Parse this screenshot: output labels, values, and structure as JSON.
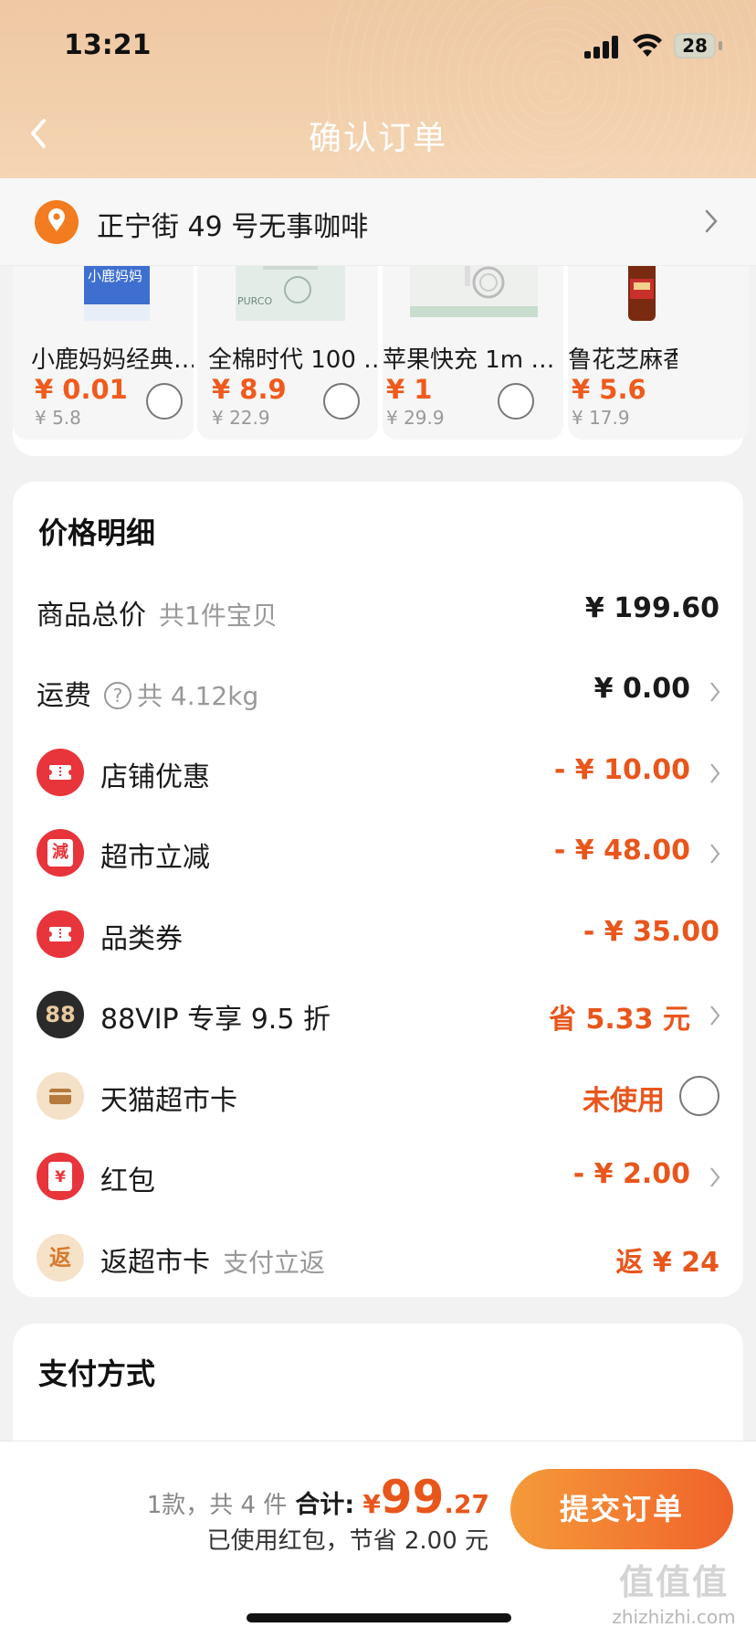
{
  "status_bar": {
    "time": "13:21",
    "battery": "28"
  },
  "header": {
    "title": "确认订单"
  },
  "address": {
    "text": "正宁街 49 号无事咖啡"
  },
  "products": [
    {
      "name": "小鹿妈妈经典…",
      "price": "¥ 0.01",
      "original": "¥ 5.8",
      "thumb_text": "小鹿妈妈"
    },
    {
      "name": "全棉时代 100 …",
      "price": "¥ 8.9",
      "original": "¥ 22.9",
      "thumb_text": "PURCO"
    },
    {
      "name": "苹果快充 1m …",
      "price": "¥ 1",
      "original": "¥ 29.9",
      "thumb_text": ""
    },
    {
      "name": "鲁花芝麻香",
      "price": "¥ 5.6",
      "original": "¥ 17.9",
      "thumb_text": ""
    }
  ],
  "price_detail": {
    "title": "价格明细",
    "rows": [
      {
        "label": "商品总价",
        "sub": "共1件宝贝",
        "value": "¥ 199.60"
      },
      {
        "label": "运费",
        "help": "?",
        "sub": "共 4.12kg",
        "value": "¥ 0.00"
      },
      {
        "label": "店铺优惠",
        "value": "- ¥ 10.00",
        "icon_text": ""
      },
      {
        "label": "超市立减",
        "value": "- ¥ 48.00",
        "icon_text": "減"
      },
      {
        "label": "品类券",
        "value": "- ¥ 35.00",
        "icon_text": ""
      },
      {
        "label": "88VIP 专享 9.5 折",
        "value": "省 5.33 元",
        "icon_text": "88"
      },
      {
        "label": "天猫超市卡",
        "value": "未使用",
        "icon_text": ""
      },
      {
        "label": "红包",
        "value": "- ¥ 2.00",
        "icon_text": "¥"
      },
      {
        "label": "返超市卡",
        "sub": "支付立返",
        "value": "返 ¥ 24",
        "icon_text": "返"
      }
    ]
  },
  "payment": {
    "title": "支付方式"
  },
  "bottom_bar": {
    "count": "1款，共 4 件",
    "total_label": "合计:",
    "yen": "¥",
    "total_int": "99",
    "total_dec": ".27",
    "saved": "已使用红包，节省 2.00 元",
    "submit": "提交订单"
  },
  "watermark": {
    "logo": "值值值",
    "url": "zhizhizhi.com"
  },
  "colors": {
    "accent": "#e8561c",
    "header": "#f2cfab",
    "red_icon": "#e8343b"
  }
}
